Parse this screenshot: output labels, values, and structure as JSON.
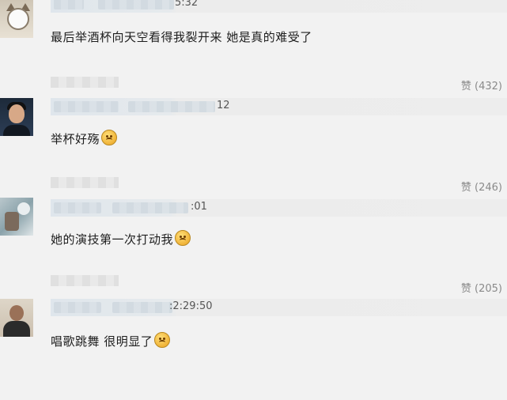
{
  "comments": [
    {
      "time": "5:32",
      "text": "最后举酒杯向天空看得我裂开来 她是真的难受了",
      "emoji": false,
      "likes_label": "赞",
      "likes": "(432)",
      "avatar": "cat-avatar"
    },
    {
      "time": "12",
      "text": "举杯好殇",
      "emoji": true,
      "likes_label": "赞",
      "likes": "(246)",
      "avatar": "man-avatar"
    },
    {
      "time": ":01",
      "text": "她的演技第一次打动我",
      "emoji": true,
      "likes_label": "赞",
      "likes": "(205)",
      "avatar": "photo-avatar"
    },
    {
      "time": ":2:29:50",
      "text": "唱歌跳舞 很明显了",
      "emoji": true,
      "likes_label": "",
      "likes": "",
      "avatar": "suit-avatar"
    }
  ],
  "colors": {
    "background": "#f2f2f2",
    "like_text": "#8a8a8a"
  },
  "icons": {
    "emoji": "sad-face-emoji-icon"
  }
}
